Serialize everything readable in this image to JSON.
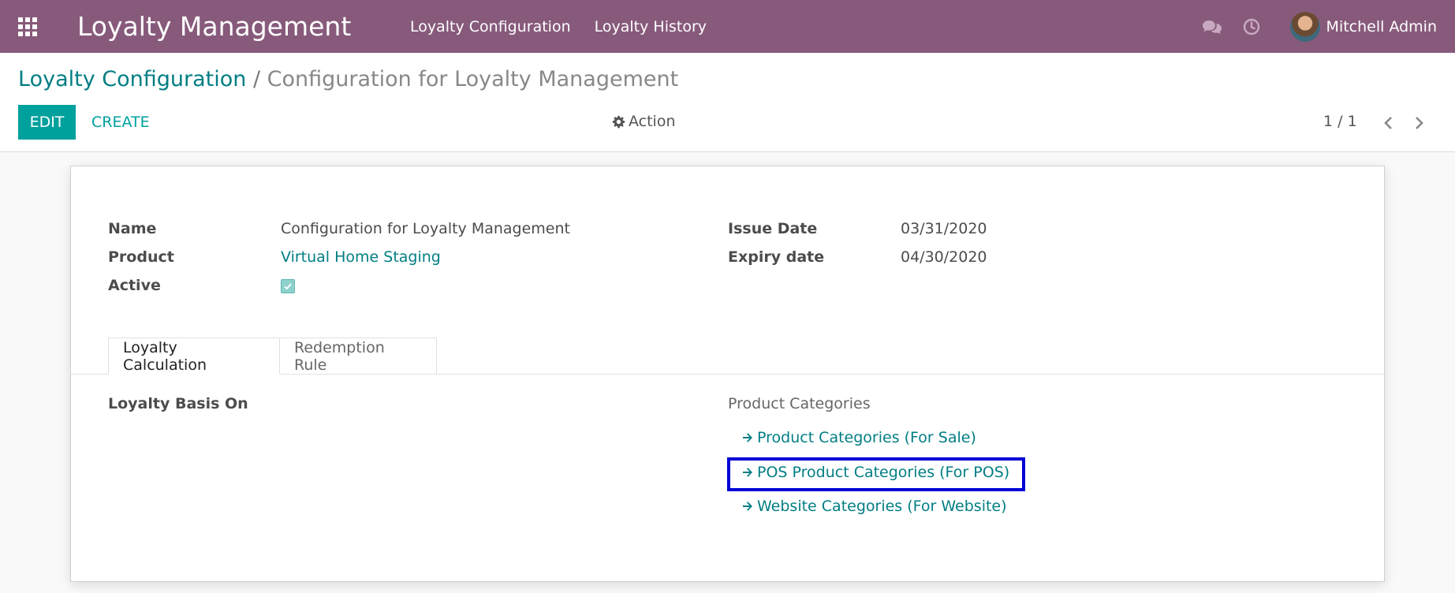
{
  "navbar": {
    "app_title": "Loyalty Management",
    "menu": [
      "Loyalty Configuration",
      "Loyalty History"
    ],
    "user_name": "Mitchell Admin",
    "icons": [
      "apps-icon",
      "chat-icon",
      "clock-icon",
      "avatar"
    ]
  },
  "breadcrumb": {
    "parent": "Loyalty Configuration",
    "separator": "/",
    "current": "Configuration for Loyalty Management"
  },
  "toolbar": {
    "edit_label": "EDIT",
    "create_label": "CREATE",
    "action_label": "Action",
    "pager": "1 / 1"
  },
  "form": {
    "name_label": "Name",
    "name_value": "Configuration for Loyalty Management",
    "product_label": "Product",
    "product_value": "Virtual Home Staging",
    "active_label": "Active",
    "active_checked": true,
    "issue_date_label": "Issue Date",
    "issue_date_value": "03/31/2020",
    "expiry_date_label": "Expiry date",
    "expiry_date_value": "04/30/2020"
  },
  "tabs": [
    {
      "label": "Loyalty Calculation",
      "active": true
    },
    {
      "label": "Redemption Rule",
      "active": false
    }
  ],
  "loyalty_calc": {
    "basis_label": "Loyalty Basis On",
    "categories_title": "Product Categories",
    "links": [
      "Product Categories (For Sale)",
      "POS Product Categories (For POS)",
      "Website Categories (For Website)"
    ],
    "highlighted_index": 1
  },
  "colors": {
    "navbar": "#875a7b",
    "accent": "#00a09d",
    "link": "#017e84",
    "highlight": "#0000d6"
  }
}
